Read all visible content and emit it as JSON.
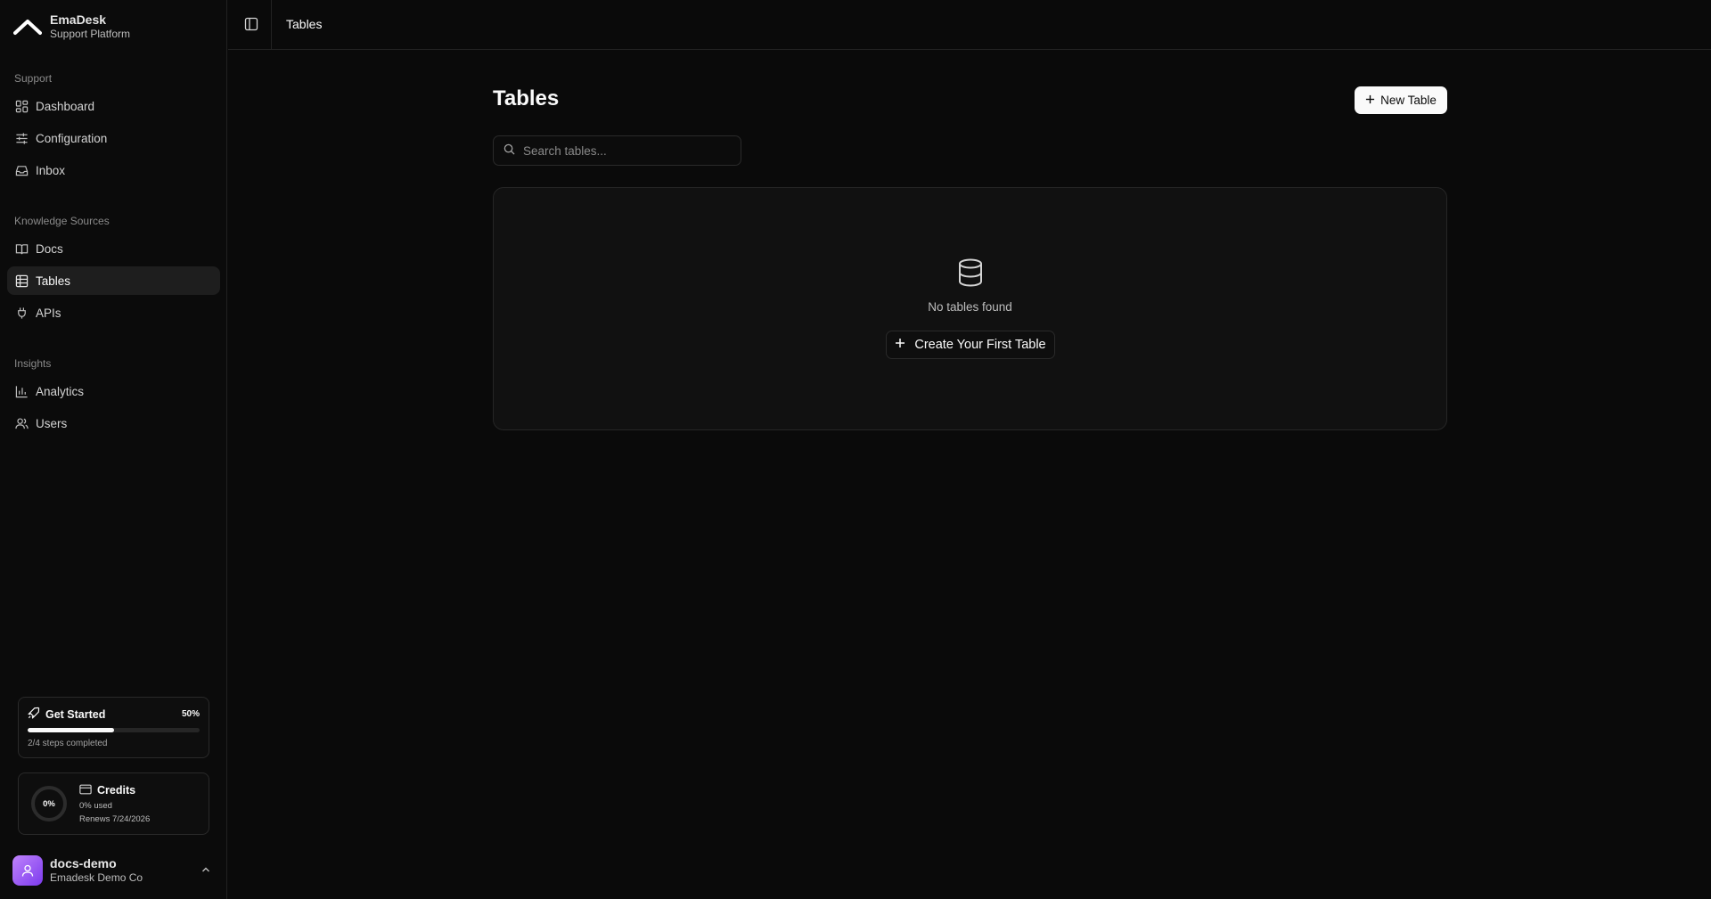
{
  "brand": {
    "title": "EmaDesk",
    "subtitle": "Support Platform"
  },
  "sidebar": {
    "sections": [
      {
        "label": "Support",
        "items": [
          {
            "label": "Dashboard",
            "icon": "dashboard-icon"
          },
          {
            "label": "Configuration",
            "icon": "sliders-icon"
          },
          {
            "label": "Inbox",
            "icon": "inbox-icon"
          }
        ]
      },
      {
        "label": "Knowledge Sources",
        "items": [
          {
            "label": "Docs",
            "icon": "book-icon"
          },
          {
            "label": "Tables",
            "icon": "table-icon",
            "active": true
          },
          {
            "label": "APIs",
            "icon": "plug-icon"
          }
        ]
      },
      {
        "label": "Insights",
        "items": [
          {
            "label": "Analytics",
            "icon": "bar-chart-icon"
          },
          {
            "label": "Users",
            "icon": "users-icon"
          }
        ]
      }
    ]
  },
  "get_started": {
    "title": "Get Started",
    "percent_label": "50%",
    "progress": 0.5,
    "steps": "2/4 steps completed"
  },
  "credits": {
    "title": "Credits",
    "ring_label": "0%",
    "used": "0% used",
    "renews": "Renews 7/24/2026"
  },
  "user": {
    "name": "docs-demo",
    "org": "Emadesk Demo Co"
  },
  "topbar": {
    "breadcrumb": "Tables"
  },
  "main": {
    "title": "Tables",
    "new_button": "New Table",
    "search_placeholder": "Search tables...",
    "search_value": "",
    "empty_text": "No tables found",
    "create_button": "Create Your First Table"
  },
  "colors": {
    "background": "#0a0a0a",
    "panel": "#111111",
    "border": "#262626",
    "active_nav": "#1e1e1e",
    "accent": "#fafafa",
    "avatar": "#a855f7"
  }
}
